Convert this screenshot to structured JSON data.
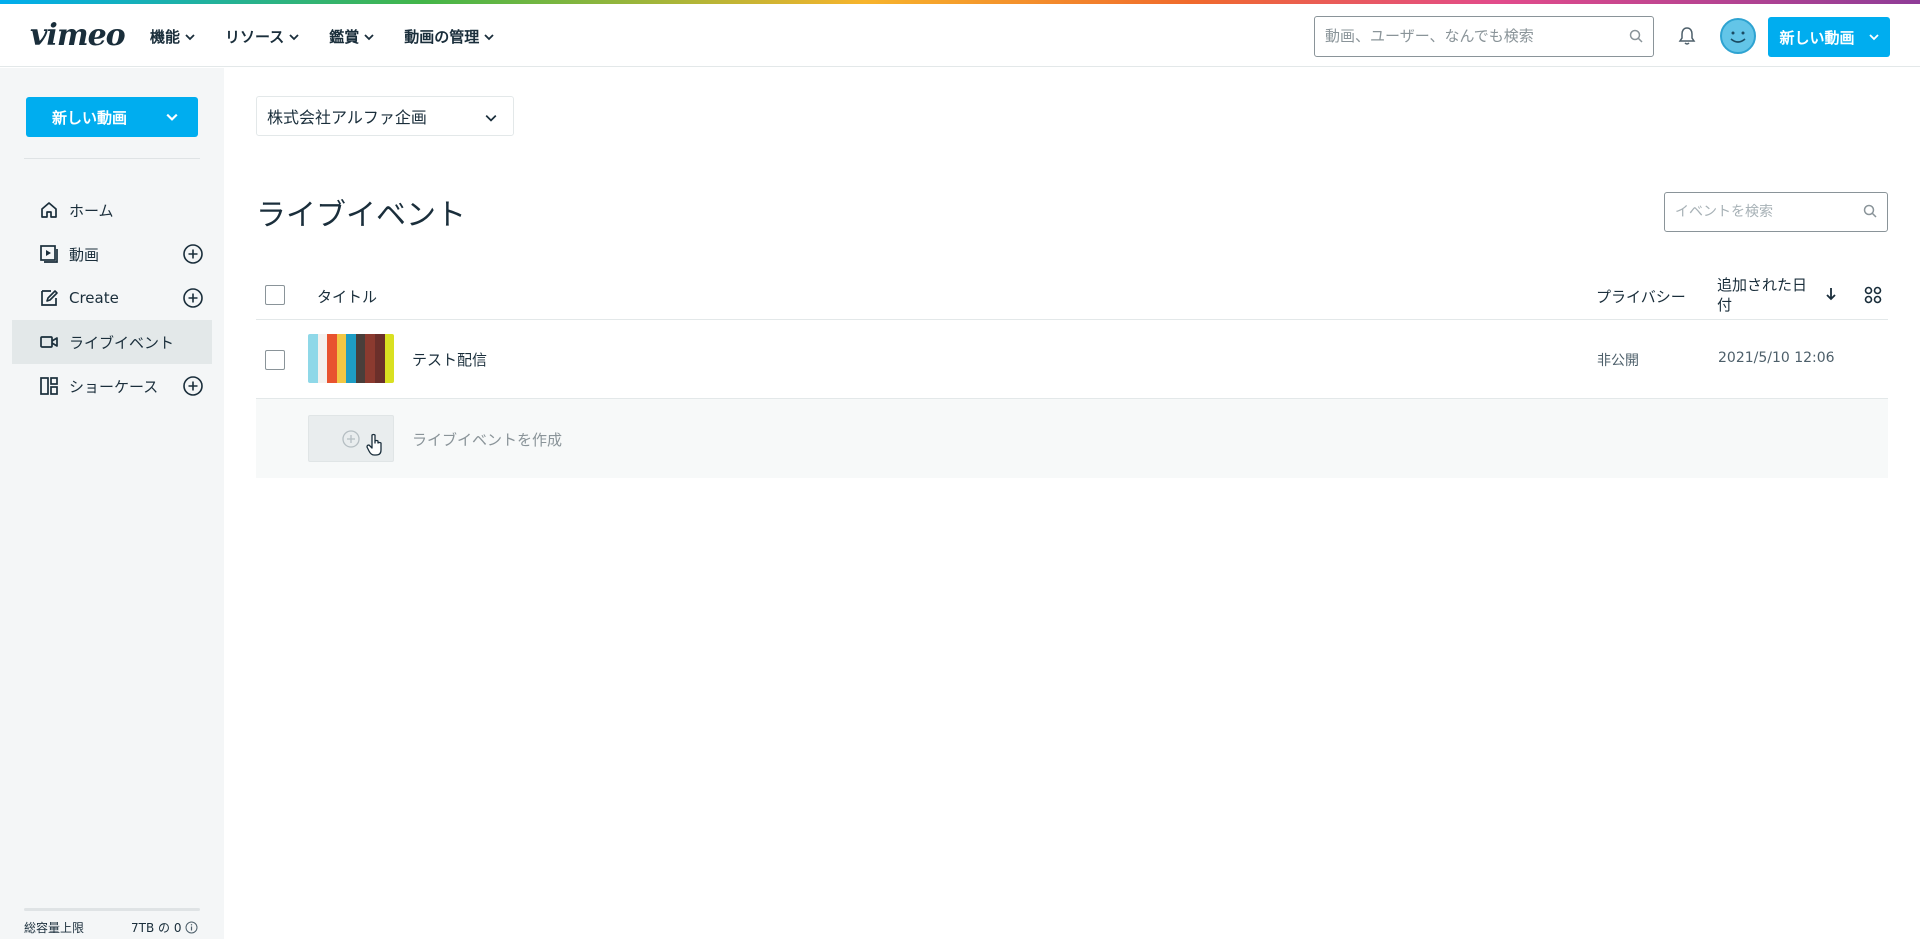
{
  "header": {
    "logo": "vimeo",
    "nav": [
      "機能",
      "リソース",
      "鑑賞",
      "動画の管理"
    ],
    "search_placeholder": "動画、ユーザー、なんでも検索",
    "new_video_label": "新しい動画"
  },
  "sidebar": {
    "new_video_label": "新しい動画",
    "items": [
      {
        "label": "ホーム",
        "icon": "home-icon",
        "active": false,
        "has_plus": false
      },
      {
        "label": "動画",
        "icon": "video-library-icon",
        "active": false,
        "has_plus": true
      },
      {
        "label": "Create",
        "icon": "create-icon",
        "active": false,
        "has_plus": true
      },
      {
        "label": "ライブイベント",
        "icon": "live-camera-icon",
        "active": true,
        "has_plus": false
      },
      {
        "label": "ショーケース",
        "icon": "showcase-icon",
        "active": false,
        "has_plus": true
      }
    ],
    "storage_label": "総容量上限",
    "storage_value": "7TB の 0"
  },
  "main": {
    "team_name": "株式会社アルファ企画",
    "page_title": "ライブイベント",
    "search_placeholder": "イベントを検索",
    "table": {
      "col_title": "タイトル",
      "col_privacy": "プライバシー",
      "col_date": "追加された日付",
      "rows": [
        {
          "title": "テスト配信",
          "privacy": "非公開",
          "date": "2021/5/10 12:06"
        }
      ],
      "create_label": "ライブイベントを作成"
    }
  },
  "colors": {
    "accent": "#00adef",
    "text": "#1a2e3b",
    "sidebar_bg": "#f4f6f7",
    "thumb_stripes": [
      "#8fd8e8",
      "#f4f1ee",
      "#e8532f",
      "#f2c744",
      "#1e9dc4",
      "#4a3e3a",
      "#8b3a2f",
      "#6b2f2a",
      "#d9e021"
    ]
  }
}
